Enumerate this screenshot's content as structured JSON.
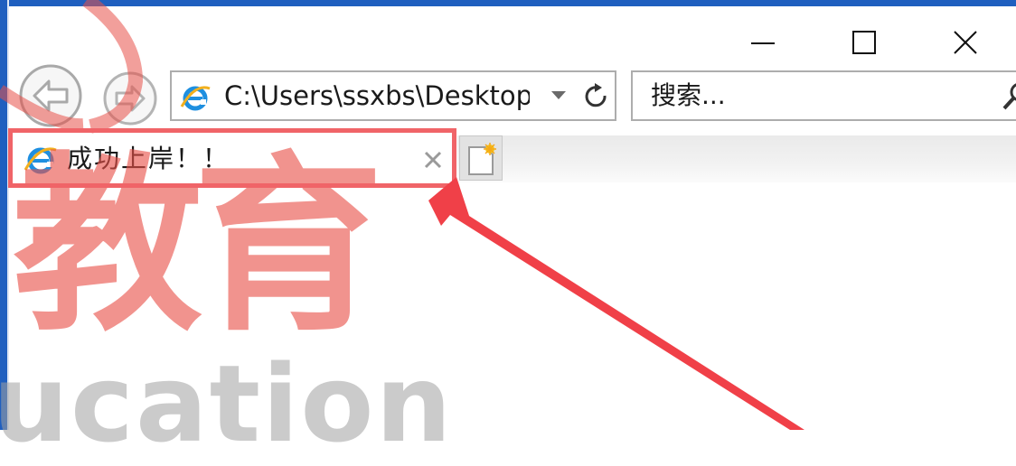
{
  "window": {
    "controls": {
      "minimize": "minimize-icon",
      "maximize": "maximize-icon",
      "close": "close-icon"
    }
  },
  "toolbar": {
    "back_icon": "back-arrow-icon",
    "forward_icon": "forward-arrow-icon",
    "address": {
      "value": "C:\\Users\\ssxbs\\Desktop",
      "site_icon": "ie-logo-icon",
      "dropdown_icon": "dropdown-triangle-icon",
      "refresh_icon": "refresh-icon"
    },
    "search": {
      "placeholder": "搜索...",
      "icon": "magnifier-icon"
    }
  },
  "tabs": [
    {
      "title": "成功上岸！！",
      "icon": "ie-logo-icon",
      "close_icon": "close-tab-icon",
      "active": true
    }
  ],
  "new_tab": {
    "icon": "new-tab-icon"
  },
  "annotation": {
    "highlight_color": "#f06468",
    "arrow_color": "#f04048"
  },
  "watermark": {
    "chinese": "教育",
    "english": "ucation",
    "color": "#e85048"
  }
}
